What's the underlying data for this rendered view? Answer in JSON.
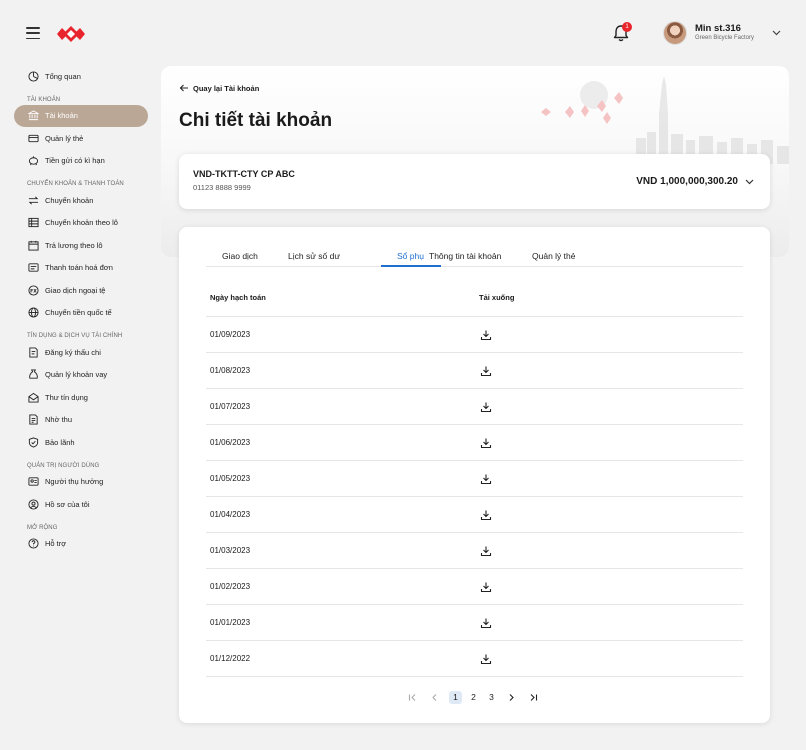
{
  "app": {
    "logo": "bank-logo",
    "notification_count": "1",
    "user": {
      "name": "Min st.316",
      "org": "Green Bicycle Factory"
    }
  },
  "sidebar": {
    "overview": "Tổng quan",
    "sections": [
      {
        "title": "TÀI KHOẢN",
        "items": [
          "Tài khoản",
          "Quản lý thẻ",
          "Tiền gửi có kì hạn"
        ]
      },
      {
        "title": "CHUYỂN KHOẢN & THANH TOÁN",
        "items": [
          "Chuyển khoản",
          "Chuyển khoản theo lô",
          "Trả lương theo lô",
          "Thanh toán hoá đơn",
          "Giao dịch ngoại tệ",
          "Chuyển tiền quốc tế"
        ]
      },
      {
        "title": "TÍN DỤNG & DỊCH VỤ TÀI CHÍNH",
        "items": [
          "Đăng ký thấu chi",
          "Quản lý khoản vay",
          "Thư tín dụng",
          "Nhờ thu",
          "Bảo lãnh"
        ]
      },
      {
        "title": "QUẢN TRỊ NGƯỜI DÙNG",
        "items": [
          "Người thụ hưởng",
          "Hồ sơ của tôi"
        ]
      },
      {
        "title": "MỞ RỘNG",
        "items": [
          "Hỗ trợ"
        ]
      }
    ],
    "active_item": "Tài khoản"
  },
  "header": {
    "back_label": "Quay lại Tài khoản",
    "title": "Chi tiết tài khoản"
  },
  "account": {
    "name": "VND-TKTT-CTY CP ABC",
    "number": "01123 8888 9999",
    "balance": "VND 1,000,000,300.20"
  },
  "tabs": [
    "Giao dịch",
    "Lịch sử số dư",
    "Sổ phụ",
    "Thông tin tài khoản",
    "Quản lý thẻ"
  ],
  "active_tab": "Sổ phụ",
  "table": {
    "headers": [
      "Ngày hạch toán",
      "Tải xuống"
    ],
    "rows": [
      "01/09/2023",
      "01/08/2023",
      "01/07/2023",
      "01/06/2023",
      "01/05/2023",
      "01/04/2023",
      "01/03/2023",
      "01/02/2023",
      "01/01/2023",
      "01/12/2022"
    ]
  },
  "pagination": {
    "pages": [
      "1",
      "2",
      "3"
    ],
    "current": "1"
  },
  "colors": {
    "brand_red": "#e8242c",
    "active_sidebar": "#bba796",
    "tab_accent": "#1f6fd1"
  }
}
